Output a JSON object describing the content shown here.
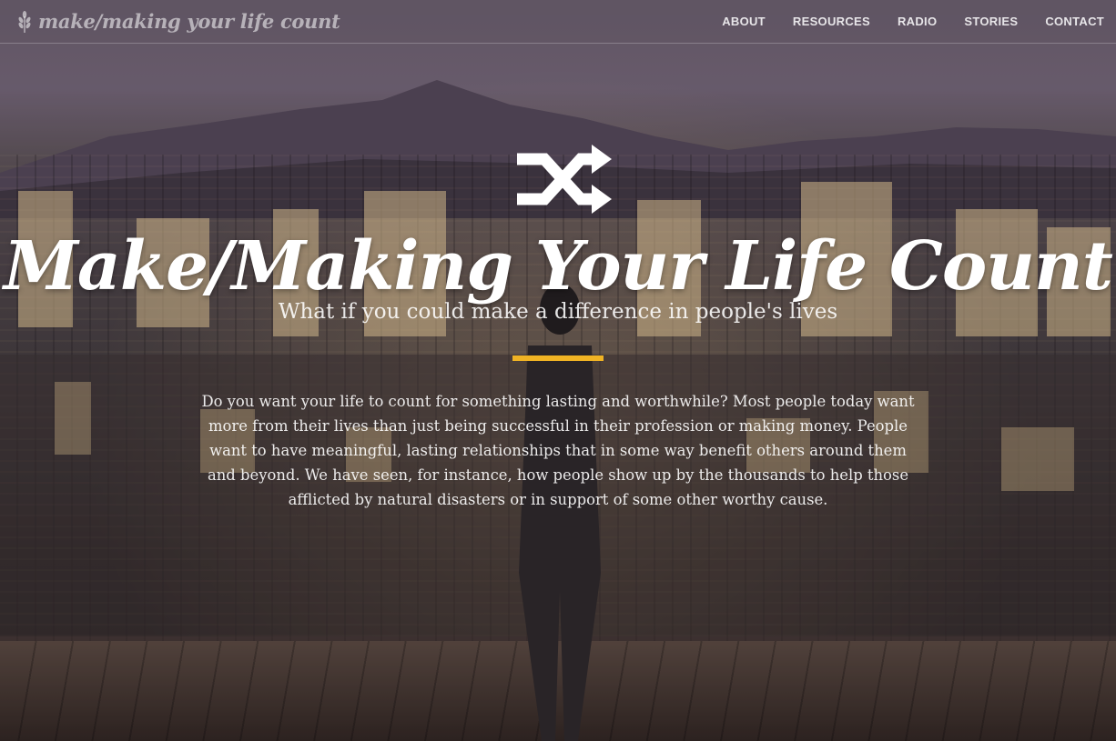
{
  "header": {
    "brand": "make/making your life count",
    "nav": [
      "ABOUT",
      "RESOURCES",
      "RADIO",
      "STORIES",
      "CONTACT"
    ]
  },
  "hero": {
    "icon": "shuffle-icon",
    "title": "Make/Making Your Life Count",
    "subtitle": "What if you could make a difference in people's lives",
    "accent_color": "#f0b324",
    "body": "Do you want your life to count for something lasting and worthwhile? Most people today want more from their lives than just being successful in their profession or making money. People want to have meaningful, lasting relationships that in some way benefit others around them and beyond. We have seen, for instance, how people show up by the thousands to help those afflicted by natural disasters or in support of some other worthy cause."
  }
}
